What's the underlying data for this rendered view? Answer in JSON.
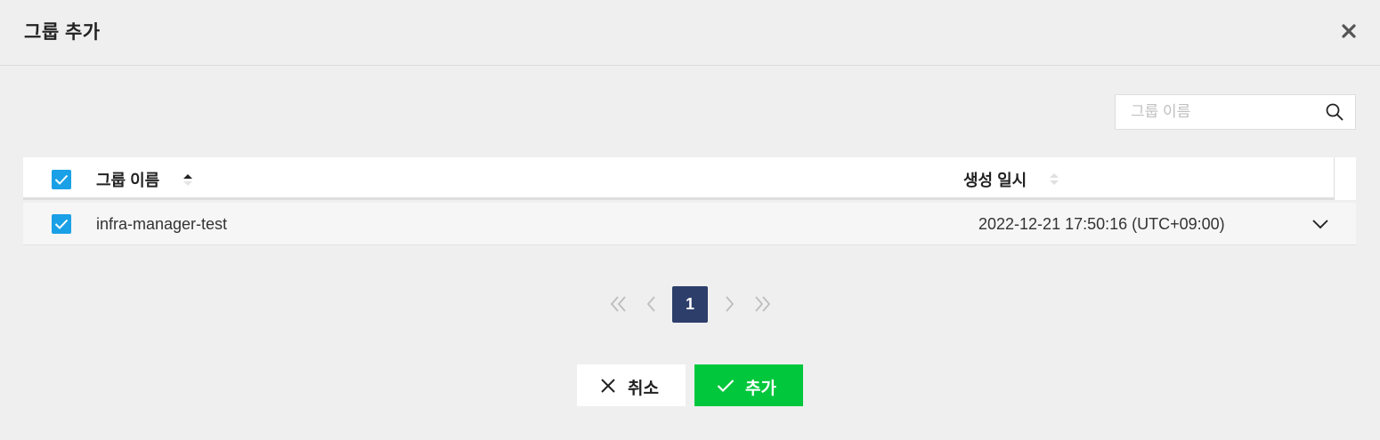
{
  "modal": {
    "title": "그룹 추가"
  },
  "search": {
    "placeholder": "그룹 이름"
  },
  "table": {
    "columns": [
      {
        "label": "그룹 이름",
        "sort": "ascending"
      },
      {
        "label": "생성 일시",
        "sort": "none"
      }
    ],
    "header_checked": true,
    "rows": [
      {
        "checked": true,
        "name": "infra-manager-test",
        "created": "2022-12-21 17:50:16 (UTC+09:00)"
      }
    ]
  },
  "pagination": {
    "current_page": "1"
  },
  "buttons": {
    "cancel_label": "취소",
    "add_label": "추가"
  },
  "colors": {
    "accent_checkbox": "#1aa0e6",
    "page_active": "#2d3e6b",
    "add_button": "#00c73c"
  },
  "icons": [
    "close-icon",
    "search-icon",
    "sort-asc-icon",
    "sort-icon",
    "chevron-down-icon",
    "double-chevron-left-icon",
    "chevron-left-icon",
    "chevron-right-icon",
    "double-chevron-right-icon",
    "x-icon",
    "check-icon"
  ]
}
